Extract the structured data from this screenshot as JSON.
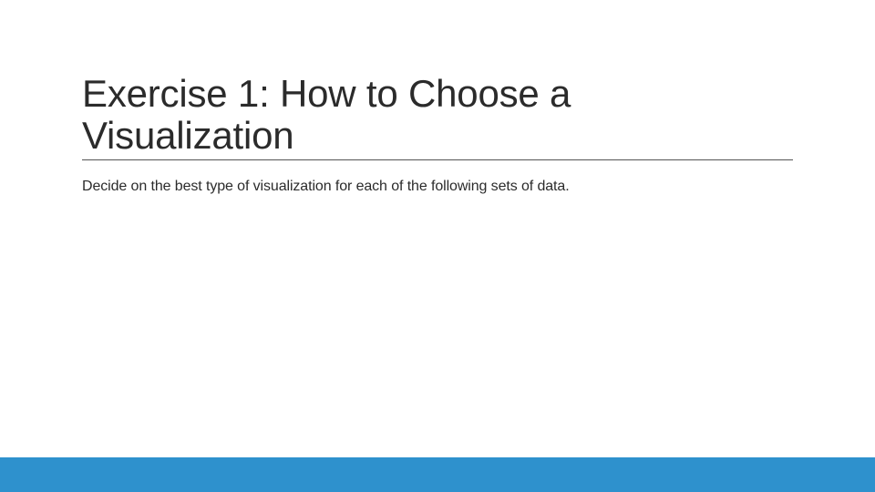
{
  "slide": {
    "title": "Exercise 1: How to Choose a Visualization",
    "body": "Decide on the best type of visualization for each of the following sets of data."
  },
  "theme": {
    "accent_bar_color": "#2E91CD"
  }
}
